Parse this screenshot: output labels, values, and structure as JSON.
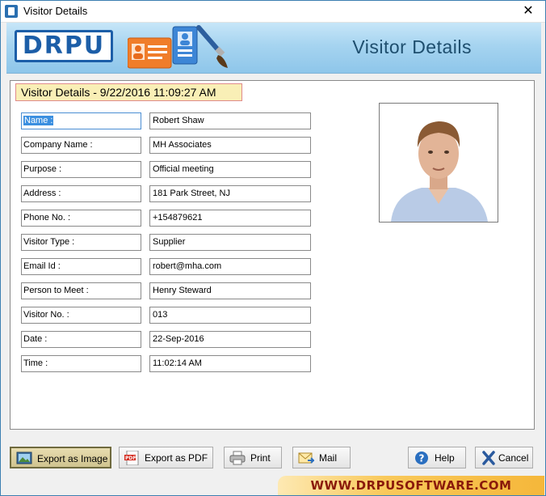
{
  "window": {
    "title": "Visitor Details"
  },
  "banner": {
    "logo_text": "DRPU",
    "title": "Visitor Details"
  },
  "header": {
    "text": "Visitor Details - 9/22/2016 11:09:27 AM"
  },
  "fields": [
    {
      "label": "Name :",
      "value": "Robert Shaw"
    },
    {
      "label": "Company Name :",
      "value": "MH Associates"
    },
    {
      "label": "Purpose :",
      "value": "Official meeting"
    },
    {
      "label": "Address :",
      "value": "181 Park Street, NJ"
    },
    {
      "label": "Phone No. :",
      "value": "+154879621"
    },
    {
      "label": "Visitor Type :",
      "value": "Supplier"
    },
    {
      "label": "Email Id :",
      "value": "robert@mha.com"
    },
    {
      "label": "Person to Meet :",
      "value": "Henry Steward"
    },
    {
      "label": "Visitor No. :",
      "value": "013"
    },
    {
      "label": "Date :",
      "value": "22-Sep-2016"
    },
    {
      "label": "Time :",
      "value": "11:02:14 AM"
    }
  ],
  "buttons": {
    "export_image": "Export as Image",
    "export_pdf": "Export as PDF",
    "print": "Print",
    "mail": "Mail",
    "help": "Help",
    "cancel": "Cancel"
  },
  "footer": {
    "website": "WWW.DRPUSOFTWARE.COM"
  },
  "colors": {
    "accent": "#1c5ea8",
    "banner": "#a6d4f0",
    "header_bg": "#f9efb6"
  }
}
